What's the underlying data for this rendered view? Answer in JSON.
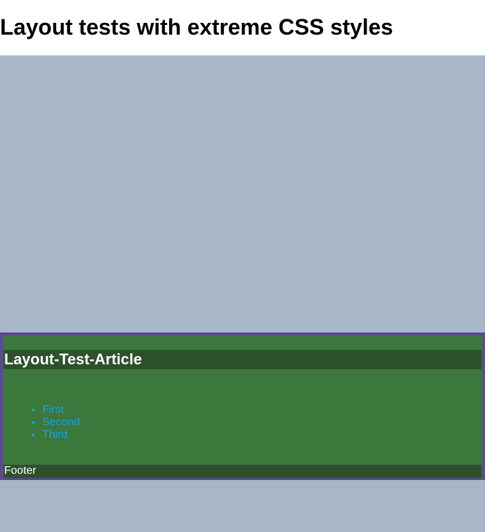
{
  "page": {
    "title": "Layout tests with extreme CSS styles"
  },
  "article": {
    "title": "Layout-Test-Article",
    "items": [
      "First",
      "Second",
      "Third"
    ],
    "footer": "Footer"
  },
  "colors": {
    "page_background": "#ffffff",
    "viewport_background": "#a9b6c7",
    "article_background": "#3c773c",
    "article_header_background": "#2c512c",
    "article_border": "#5a4a8e",
    "link_color": "#1aa3e0",
    "article_text": "#ffffff"
  }
}
